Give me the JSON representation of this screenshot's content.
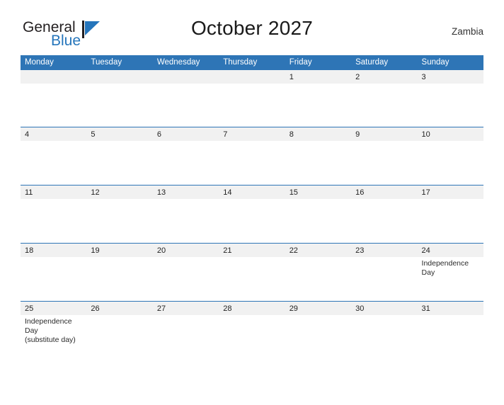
{
  "brand": {
    "name_part1": "General",
    "name_part2": "Blue",
    "flag_color": "#2575bb"
  },
  "header": {
    "title": "October 2027",
    "country": "Zambia"
  },
  "theme": {
    "header_blue": "#2e75b6",
    "band_gray": "#f1f1f1",
    "text_dark": "#222222"
  },
  "calendar": {
    "weekdays": [
      "Monday",
      "Tuesday",
      "Wednesday",
      "Thursday",
      "Friday",
      "Saturday",
      "Sunday"
    ],
    "weeks": [
      {
        "days": [
          {
            "date": "",
            "event": ""
          },
          {
            "date": "",
            "event": ""
          },
          {
            "date": "",
            "event": ""
          },
          {
            "date": "",
            "event": ""
          },
          {
            "date": "1",
            "event": ""
          },
          {
            "date": "2",
            "event": ""
          },
          {
            "date": "3",
            "event": ""
          }
        ]
      },
      {
        "days": [
          {
            "date": "4",
            "event": ""
          },
          {
            "date": "5",
            "event": ""
          },
          {
            "date": "6",
            "event": ""
          },
          {
            "date": "7",
            "event": ""
          },
          {
            "date": "8",
            "event": ""
          },
          {
            "date": "9",
            "event": ""
          },
          {
            "date": "10",
            "event": ""
          }
        ]
      },
      {
        "days": [
          {
            "date": "11",
            "event": ""
          },
          {
            "date": "12",
            "event": ""
          },
          {
            "date": "13",
            "event": ""
          },
          {
            "date": "14",
            "event": ""
          },
          {
            "date": "15",
            "event": ""
          },
          {
            "date": "16",
            "event": ""
          },
          {
            "date": "17",
            "event": ""
          }
        ]
      },
      {
        "days": [
          {
            "date": "18",
            "event": ""
          },
          {
            "date": "19",
            "event": ""
          },
          {
            "date": "20",
            "event": ""
          },
          {
            "date": "21",
            "event": ""
          },
          {
            "date": "22",
            "event": ""
          },
          {
            "date": "23",
            "event": ""
          },
          {
            "date": "24",
            "event": "Independence Day"
          }
        ]
      },
      {
        "days": [
          {
            "date": "25",
            "event": "Independence Day\n(substitute day)"
          },
          {
            "date": "26",
            "event": ""
          },
          {
            "date": "27",
            "event": ""
          },
          {
            "date": "28",
            "event": ""
          },
          {
            "date": "29",
            "event": ""
          },
          {
            "date": "30",
            "event": ""
          },
          {
            "date": "31",
            "event": ""
          }
        ]
      }
    ]
  }
}
